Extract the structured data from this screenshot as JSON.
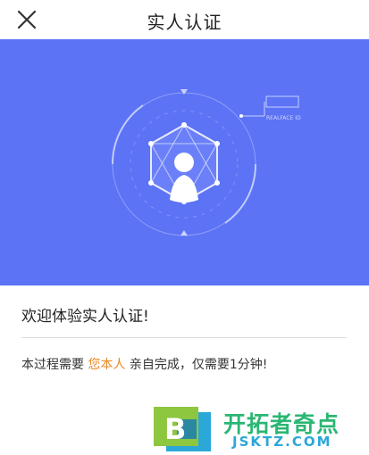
{
  "header": {
    "title": "实人认证",
    "close_icon": "close-icon"
  },
  "banner": {
    "background": "#5c73f5",
    "illustration_icon": "person-in-hexagon-icon",
    "caption": "REALFACE ID"
  },
  "content": {
    "welcome": "欢迎体验实人认证!",
    "desc_before": "本过程需要 ",
    "desc_highlight": "您本人",
    "desc_after": " 亲自完成，仅需要1分钟!",
    "highlight_color": "#e58a26"
  },
  "watermark": {
    "logo_letter": "B",
    "name": "开拓者奇点",
    "domain": "JSKTZ.COM"
  }
}
